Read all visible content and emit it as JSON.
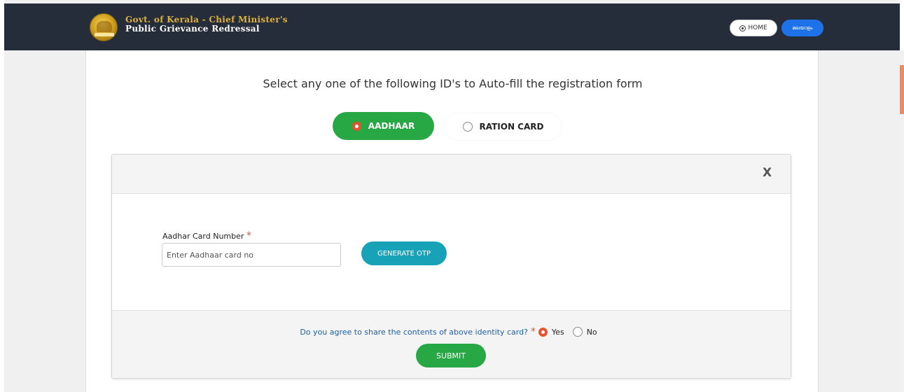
{
  "header": {
    "brand_line1": "Govt. of Kerala - Chief Minister's",
    "brand_line2": "Public Grievance Redressal",
    "home_label": "HOME",
    "lang_label": "മലയാളം"
  },
  "main": {
    "instruction": "Select any one of the following ID's to Auto-fill the registration form",
    "id_options": [
      {
        "label": "AADHAAR",
        "selected": true
      },
      {
        "label": "RATION CARD",
        "selected": false
      }
    ]
  },
  "panel": {
    "close_label": "X",
    "field_label": "Aadhar Card Number",
    "required_mark": "*",
    "input_placeholder": "Enter Aadhaar card no",
    "input_value": "",
    "otp_button": "GENERATE OTP",
    "consent_question": "Do you agree to share the contents of above identity card?",
    "consent_required_mark": "*",
    "consent_yes": "Yes",
    "consent_no": "No",
    "consent_selected": "Yes",
    "submit_button": "SUBMIT"
  },
  "colors": {
    "header_bg": "#252d3a",
    "accent_green": "#28a745",
    "accent_teal": "#18a2b8",
    "radio_orange": "#e5532c",
    "lang_blue": "#1e72e8",
    "brand_gold": "#e0b23c"
  },
  "icons": {
    "home": "home-circle-icon",
    "emblem": "kerala-emblem-icon"
  }
}
